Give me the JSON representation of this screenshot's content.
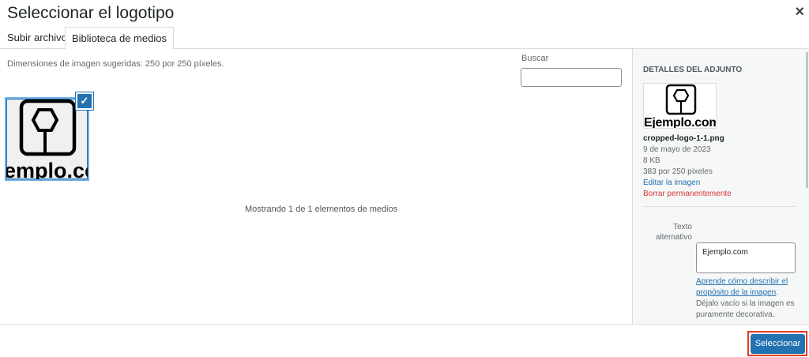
{
  "modal": {
    "title": "Seleccionar el logotipo",
    "close_icon": "×"
  },
  "tabs": [
    {
      "label": "Subir archivos"
    },
    {
      "label": "Biblioteca de medios",
      "active": true
    }
  ],
  "library": {
    "hint": "Dimensiones de imagen sugeridas: 250 por 250 píxeles.",
    "search_label": "Buscar",
    "search_value": "",
    "count_text": "Mostrando 1 de 1 elementos de medios",
    "thumb_text": "emplo.co",
    "check": "✓"
  },
  "details": {
    "heading": "DETALLES DEL ADJUNTO",
    "logo_text": "Ejemplo.com",
    "filename": "cropped-logo-1-1.png",
    "date": "9 de mayo de 2023",
    "size": "8 KB",
    "dimensions": "383 por 250 píxeles",
    "edit_link": "Editar la imagen",
    "delete_link": "Borrar permanentemente",
    "alt_label": "Texto alternativo",
    "alt_value": "Ejemplo.com",
    "help_link": "Aprende cómo describir el propósito de la imagen",
    "help_text": ". Déjalo vacío si la imagen es puramente decorativa."
  },
  "footer": {
    "select_button": "Seleccionar"
  },
  "colors": {
    "primary": "#2271b1",
    "danger": "#d63638",
    "highlight": "#e8391e"
  }
}
